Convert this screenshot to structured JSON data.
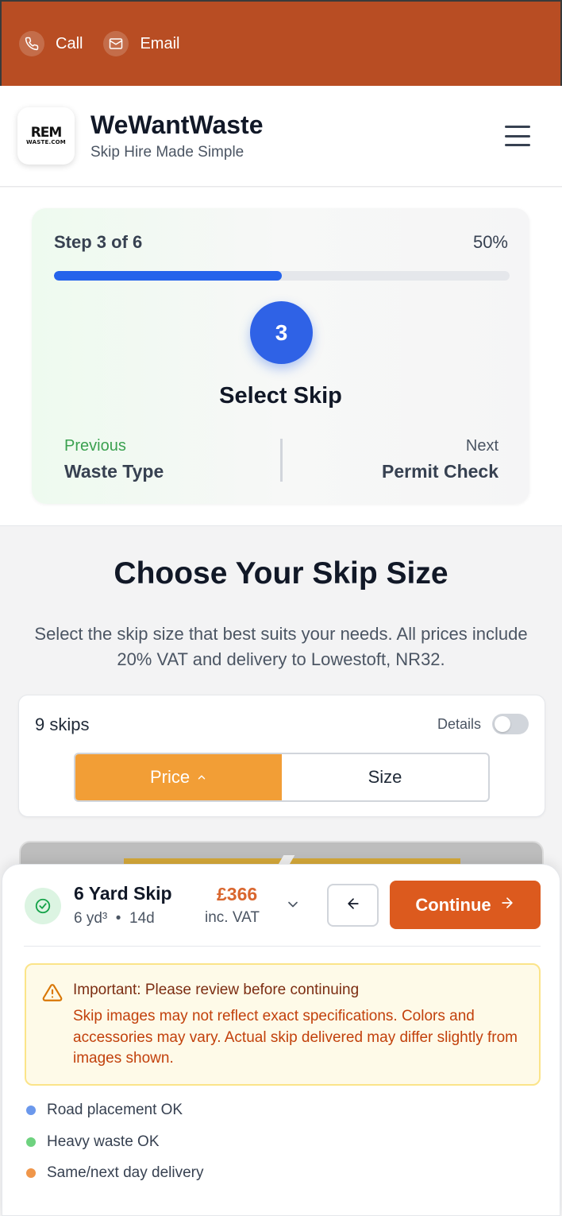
{
  "topbar": {
    "call_label": "Call",
    "email_label": "Email"
  },
  "header": {
    "logo_text_main": "REM",
    "logo_text_sub": "WASTE.COM",
    "title": "WeWantWaste",
    "subtitle": "Skip Hire Made Simple"
  },
  "progress": {
    "step_label": "Step 3 of 6",
    "percent_label": "50%",
    "percent_value": 0.5,
    "step_number": "3",
    "step_title": "Select Skip",
    "previous_label": "Previous",
    "previous_value": "Waste Type",
    "next_label": "Next",
    "next_value": "Permit Check"
  },
  "main": {
    "heading": "Choose Your Skip Size",
    "subtext": "Select the skip size that best suits your needs. All prices include 20% VAT and delivery to Lowestoft, NR32."
  },
  "filters": {
    "count_label": "9 skips",
    "details_label": "Details",
    "details_on": false,
    "sort_options": [
      "Price",
      "Size"
    ],
    "active_sort": "Price"
  },
  "selection": {
    "skip_name": "6 Yard Skip",
    "skip_size": "6 yd³",
    "hire_period": "14d",
    "price": "£366",
    "price_note": "inc. VAT",
    "continue_label": "Continue"
  },
  "warning": {
    "title": "Important: Please review before continuing",
    "body": "Skip images may not reflect exact specifications. Colors and accessories may vary. Actual skip delivered may differ slightly from images shown."
  },
  "features": [
    {
      "label": "Road placement OK",
      "color": "#6b98ec"
    },
    {
      "label": "Heavy waste OK",
      "color": "#6ed27f"
    },
    {
      "label": "Same/next day delivery",
      "color": "#f0964a"
    }
  ],
  "colors": {
    "brand": "#b84d23",
    "accent": "#dc5a1e",
    "progress": "#2563eb",
    "sort_active": "#f29e36"
  }
}
